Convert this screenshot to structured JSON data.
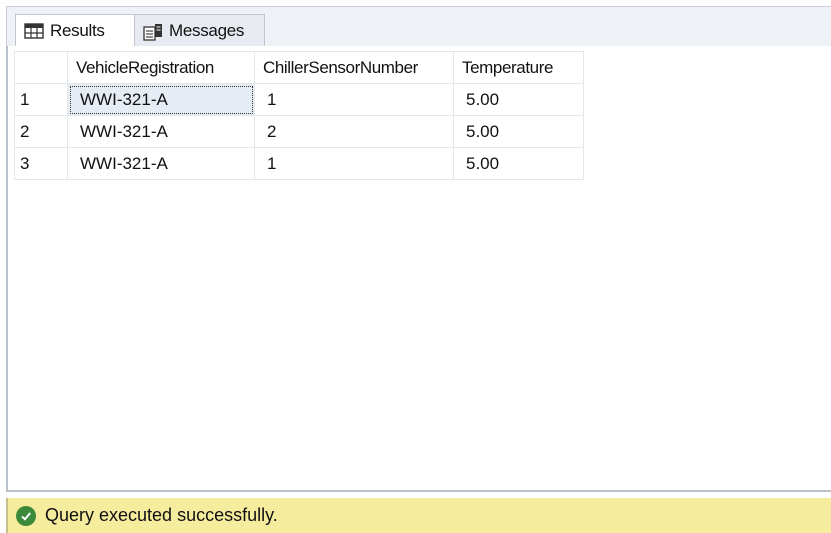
{
  "tabs": {
    "results_label": "Results",
    "messages_label": "Messages"
  },
  "grid": {
    "columns": [
      "VehicleRegistration",
      "ChillerSensorNumber",
      "Temperature"
    ],
    "rows": [
      {
        "num": "1",
        "cells": [
          "WWI-321-A",
          "1",
          "5.00"
        ]
      },
      {
        "num": "2",
        "cells": [
          "WWI-321-A",
          "2",
          "5.00"
        ]
      },
      {
        "num": "3",
        "cells": [
          "WWI-321-A",
          "1",
          "5.00"
        ]
      }
    ],
    "selected_cell": "0.0"
  },
  "status": {
    "text": "Query executed successfully.",
    "color": "#f5ec9e",
    "icon": "check-circle-icon"
  }
}
